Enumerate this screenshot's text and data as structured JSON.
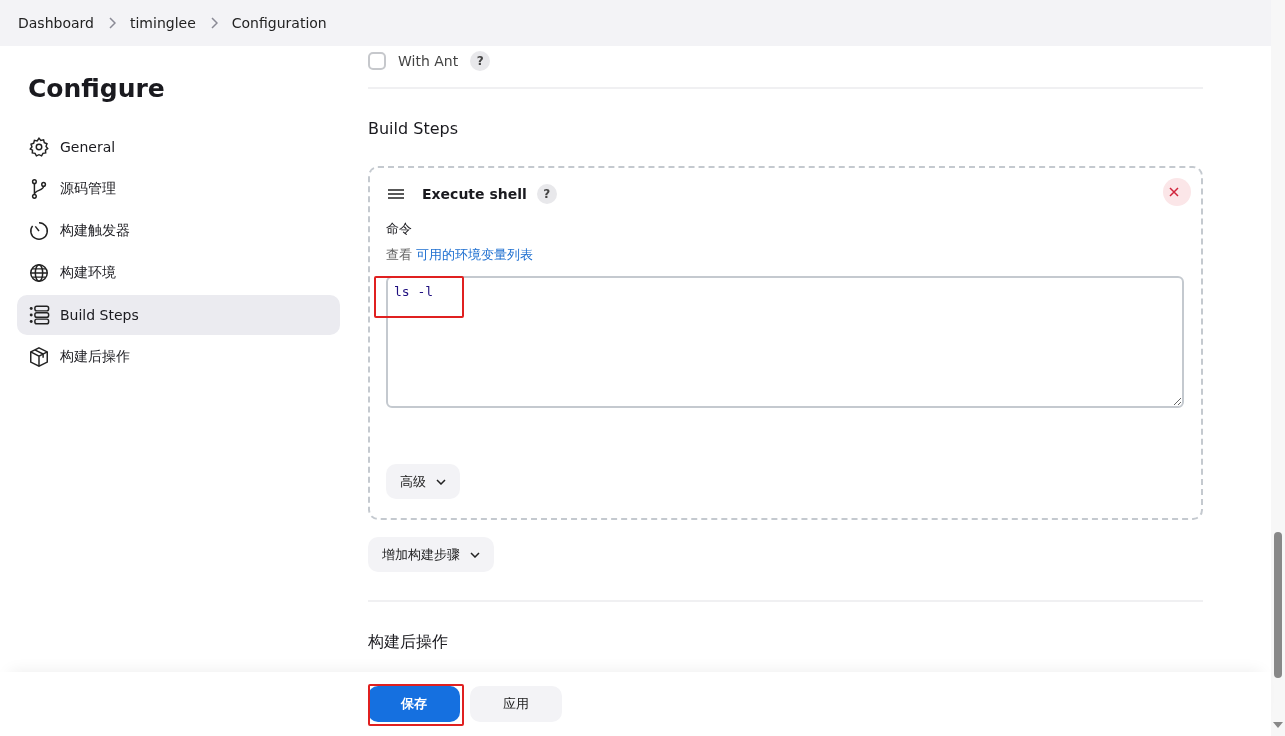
{
  "breadcrumbs": [
    "Dashboard",
    "timinglee",
    "Configuration"
  ],
  "sidebar": {
    "title": "Configure",
    "items": [
      {
        "label": "General",
        "kind": "gear",
        "selected": false
      },
      {
        "label": "源码管理",
        "kind": "branch",
        "selected": false
      },
      {
        "label": "构建触发器",
        "kind": "timer",
        "selected": false
      },
      {
        "label": "构建环境",
        "kind": "globe",
        "selected": false
      },
      {
        "label": "Build Steps",
        "kind": "list",
        "selected": true
      },
      {
        "label": "构建后操作",
        "kind": "package",
        "selected": false
      }
    ]
  },
  "with_ant": {
    "label": "With Ant",
    "checked": false,
    "help": "?"
  },
  "build_steps": {
    "heading": "Build Steps",
    "step": {
      "title": "Execute shell",
      "help": "?",
      "field_label": "命令",
      "hint_prefix": "查看",
      "hint_link": "可用的环境变量列表",
      "command": "ls -l",
      "command_highlighted": true,
      "advanced": "高级"
    },
    "add_button": "增加构建步骤"
  },
  "post_build": {
    "heading": "构建后操作"
  },
  "buttons": [
    {
      "label": "保存",
      "kind": "primary",
      "highlighted": true
    },
    {
      "label": "应用",
      "kind": "secondary",
      "highlighted": false
    }
  ]
}
